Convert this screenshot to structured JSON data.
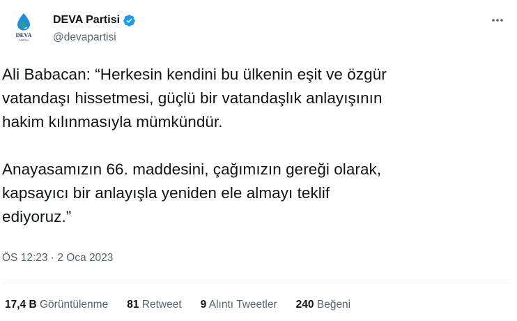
{
  "author": {
    "display_name": "DEVA Partisi",
    "handle": "@devapartisi",
    "avatar_logo": "deva-drop-logo",
    "avatar_text": "DEVA",
    "avatar_subtext": "PARTİSİ",
    "verified_icon": "verified-badge-icon"
  },
  "more_icon": "more-options-icon",
  "tweet": {
    "paragraphs": [
      "Ali Babacan: “Herkesin kendini bu ülkenin eşit ve özgür\nvatandaşı hissetmesi, güçlü bir vatandaşlık anlayışının\nhakim kılınmasıyla mümkündür.",
      "Anayasamızın 66. maddesini, çağımızın gereği olarak,\nkapsayıcı bir anlayışla yeniden ele almayı teklif\nediyoruz.”"
    ],
    "time": "ÖS 12:23",
    "separator": " · ",
    "date": "2 Oca 2023"
  },
  "stats": {
    "views": {
      "value": "17,4 B",
      "label": "Görüntülenme"
    },
    "retweets": {
      "value": "81",
      "label": "Retweet"
    },
    "quotes": {
      "value": "9",
      "label": "Alıntı Tweetler"
    },
    "likes": {
      "value": "240",
      "label": "Beğeni"
    }
  },
  "colors": {
    "brand_blue": "#1d9bf0",
    "logo_blue": "#1f8ed6",
    "logo_green": "#3aa655",
    "text_primary": "#0f1419",
    "text_secondary": "#536471"
  }
}
